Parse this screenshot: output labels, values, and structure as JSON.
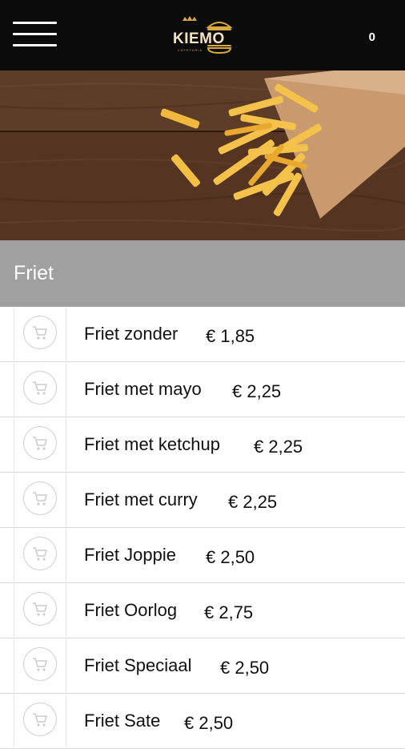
{
  "header": {
    "logo_text": "KIEMO",
    "logo_subtitle": "CAFETARIA",
    "cart_count": "0"
  },
  "category": {
    "title": "Friet"
  },
  "items": [
    {
      "name": "Friet zonder",
      "price": "€ 1,85"
    },
    {
      "name": "Friet met mayo",
      "price": "€ 2,25"
    },
    {
      "name": "Friet met ketchup",
      "price": "€ 2,25"
    },
    {
      "name": "Friet met curry",
      "price": "€ 2,25"
    },
    {
      "name": "Friet Joppie",
      "price": "€ 2,50"
    },
    {
      "name": "Friet Oorlog",
      "price": "€ 2,75"
    },
    {
      "name": "Friet Speciaal",
      "price": "€ 2,50"
    },
    {
      "name": "Friet Sate",
      "price": "€ 2,50"
    }
  ],
  "icons": {
    "menu": "hamburger-menu-icon",
    "add_to_cart": "shopping-cart-icon"
  }
}
